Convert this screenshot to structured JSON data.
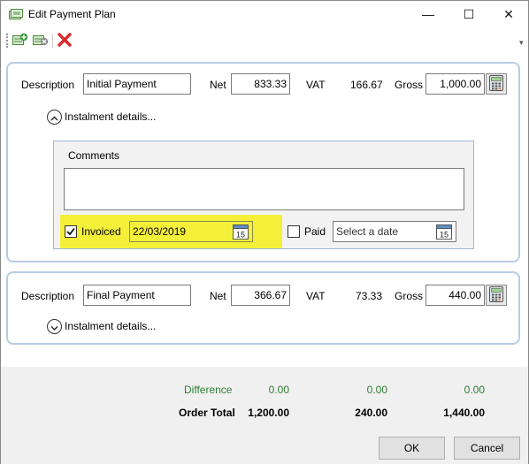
{
  "window": {
    "title": "Edit Payment Plan",
    "minimize_glyph": "—",
    "maximize_glyph": "☐",
    "close_glyph": "✕"
  },
  "toolbar": {
    "add_icon": "add-row-icon",
    "remove_icon": "remove-row-icon",
    "delete_icon": "delete-icon",
    "overflow_glyph": "▾"
  },
  "instalments": [
    {
      "description_label": "Description",
      "description": "Initial Payment",
      "net_label": "Net",
      "net": "833.33",
      "vat_label": "VAT",
      "vat": "166.67",
      "gross_label": "Gross",
      "gross": "1,000.00",
      "details_toggle": "Instalment details...",
      "expanded": true,
      "comments_label": "Comments",
      "comments": "",
      "invoiced_label": "Invoiced",
      "invoiced_checked": true,
      "invoiced_date": "22/03/2019",
      "paid_label": "Paid",
      "paid_checked": false,
      "paid_date_placeholder": "Select a date",
      "calendar_day": "15"
    },
    {
      "description_label": "Description",
      "description": "Final Payment",
      "net_label": "Net",
      "net": "366.67",
      "vat_label": "VAT",
      "vat": "73.33",
      "gross_label": "Gross",
      "gross": "440.00",
      "details_toggle": "Instalment details...",
      "expanded": false
    }
  ],
  "summary": {
    "difference_label": "Difference",
    "difference_net": "0.00",
    "difference_vat": "0.00",
    "difference_gross": "0.00",
    "total_label": "Order Total",
    "total_net": "1,200.00",
    "total_vat": "240.00",
    "total_gross": "1,440.00"
  },
  "buttons": {
    "ok": "OK",
    "cancel": "Cancel"
  },
  "colors": {
    "difference": "#2e7d32",
    "highlight": "#f4f03a",
    "panel_border": "#b9cbe6",
    "delete_red": "#d32f2f"
  }
}
